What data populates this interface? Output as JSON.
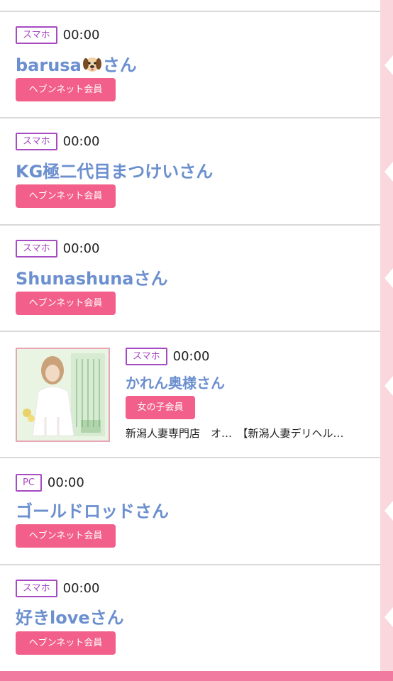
{
  "items": [
    {
      "device": "スマホ",
      "time": "00:00",
      "name_part1": "barusa",
      "name_part2": "さん",
      "member": "ヘブンネット会員",
      "has_emoji": true
    },
    {
      "device": "スマホ",
      "time": "00:00",
      "name": "KG極二代目まつけいさん",
      "member": "ヘブンネット会員"
    },
    {
      "device": "スマホ",
      "time": "00:00",
      "name": "Shunashunaさん",
      "member": "ヘブンネット会員"
    },
    {
      "device": "スマホ",
      "time": "00:00",
      "name": "かれん奥様さん",
      "member": "女の子会員",
      "shop_line": "新潟人妻専門店　オ…　【新潟人妻デリヘル…"
    },
    {
      "device": "PC",
      "time": "00:00",
      "name": "ゴールドロッドさん",
      "member": "ヘブンネット会員"
    },
    {
      "device": "スマホ",
      "time": "00:00",
      "name": "好きloveさん",
      "member": "ヘブンネット会員"
    }
  ],
  "colors": {
    "accent_pink": "#f25f8a",
    "name_blue": "#6b8fcf",
    "badge_purple": "#a64bc1"
  },
  "icons": {
    "emoji": "dog-face-icon"
  }
}
